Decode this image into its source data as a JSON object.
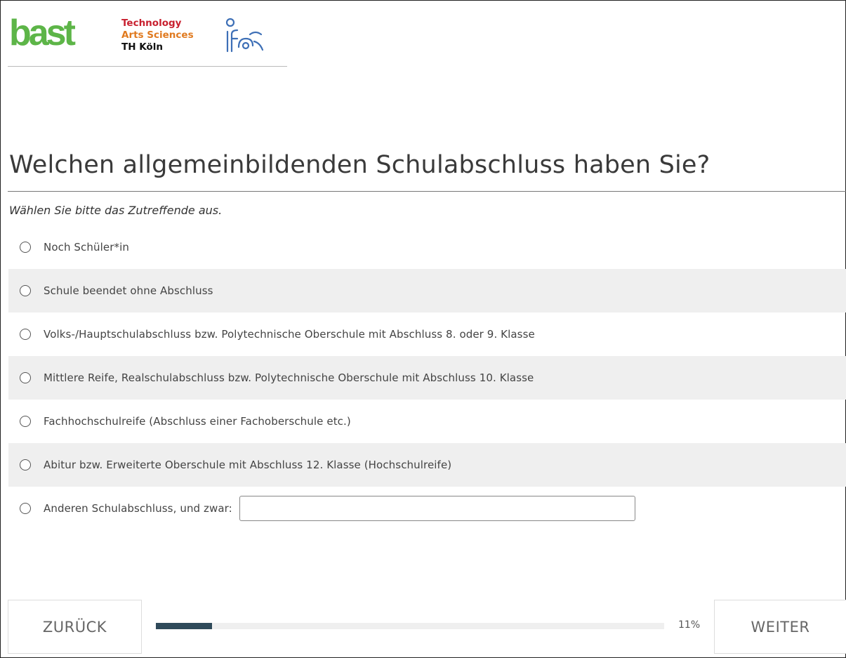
{
  "header": {
    "logos": {
      "bast": "bast",
      "th_koeln": [
        "Technology",
        "Arts Sciences",
        "TH Köln"
      ],
      "ifes": "ifes"
    },
    "colors": {
      "bast_green": "#5db548",
      "th_red": "#c8202f",
      "th_orange": "#e07a1f",
      "ifes_blue": "#3d6fb6"
    }
  },
  "question": {
    "title": "Welchen allgemeinbildenden Schulabschluss haben Sie?",
    "instruction": "Wählen Sie bitte das Zutreffende aus.",
    "options": [
      {
        "label": "Noch Schüler*in",
        "selected": false
      },
      {
        "label": "Schule beendet ohne Abschluss",
        "selected": false
      },
      {
        "label": "Volks-/Hauptschulabschluss bzw. Polytechnische Oberschule mit Abschluss 8. oder 9. Klasse",
        "selected": false
      },
      {
        "label": "Mittlere Reife, Realschulabschluss bzw. Polytechnische Oberschule mit Abschluss 10. Klasse",
        "selected": false
      },
      {
        "label": "Fachhochschulreife (Abschluss einer Fachoberschule etc.)",
        "selected": false
      },
      {
        "label": "Abitur bzw. Erweiterte Oberschule mit Abschluss 12. Klasse (Hochschulreife)",
        "selected": false
      },
      {
        "label": "Anderen Schulabschluss, und zwar:",
        "selected": false,
        "input_value": ""
      }
    ]
  },
  "footer": {
    "back_label": "ZURÜCK",
    "next_label": "WEITER",
    "progress_percent": 11,
    "progress_text": "11%",
    "progress_color": "#2f4a5a"
  }
}
